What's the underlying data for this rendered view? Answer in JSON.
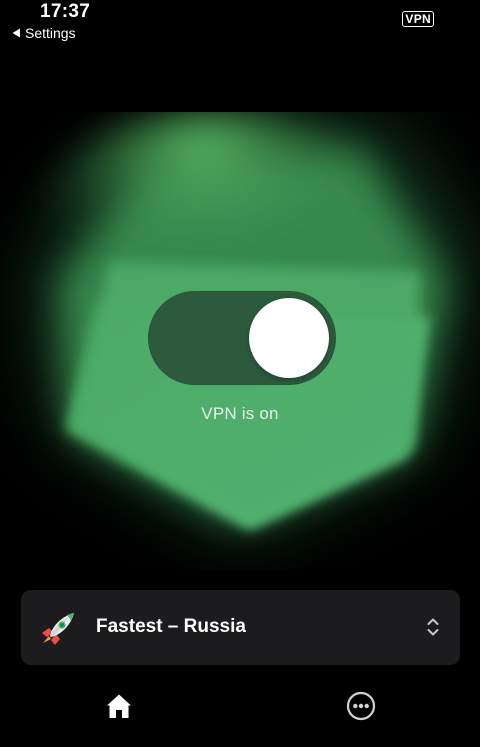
{
  "status_bar": {
    "time": "17:37",
    "back_label": "Settings",
    "vpn_badge": "VPN"
  },
  "main": {
    "vpn_enabled": true,
    "status_text": "VPN is on"
  },
  "location": {
    "label": "Fastest – Russia",
    "icon": "rocket-icon"
  },
  "tab_bar": {
    "items": [
      {
        "name": "home",
        "icon": "home-icon",
        "active": true
      },
      {
        "name": "more",
        "icon": "more-icon",
        "active": false
      }
    ]
  },
  "colors": {
    "background": "#000000",
    "accent_green": "#4eb36a",
    "toggle_track": "#2d5a3d",
    "card": "#1c1c1e"
  }
}
